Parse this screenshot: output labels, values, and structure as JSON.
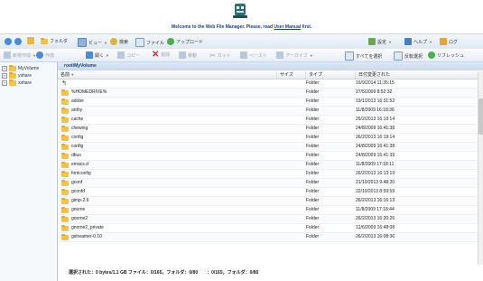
{
  "banner": {
    "welcome_text": "Welcome to the Web File Manager. Please, read",
    "manual_link": "User Manual",
    "welcome_suffix": "first."
  },
  "toolbar1": {
    "folder_label": "フォルダ",
    "view_label": "ビュー",
    "search_label": "検索",
    "file_label": "ファイル",
    "upload_label": "アップロード",
    "settings_label": "設定",
    "help_label": "ヘルプ",
    "logout_label": "ログ"
  },
  "toolbar2": {
    "new_label": "新規作成",
    "create_label": "作成",
    "open_label": "開く",
    "edit_label": "コピー",
    "delete_label": "削除",
    "copy_label": "移動",
    "cut_label": "カット",
    "paste_label": "ペースト",
    "properties_label": "アーカイブ",
    "select_all_label": "すべてを選択",
    "invert_label": "反転選択",
    "refresh_label": "リフレッシュ"
  },
  "tree": {
    "items": [
      {
        "label": "MyVolume"
      },
      {
        "label": "yshare"
      },
      {
        "label": "xshare"
      }
    ]
  },
  "main": {
    "path": "root\\MyVolume",
    "columns": {
      "name": "名前",
      "size": "サイズ",
      "type": "タイプ",
      "date": "日付変更された"
    },
    "rows": [
      {
        "name": "",
        "type": "Folder",
        "date": "16/9/2014 11:35:15",
        "up": true
      },
      {
        "name": "%HOMEDRIVE%",
        "type": "Folder",
        "date": "27/5/2009 8:52:32"
      },
      {
        "name": "adobe",
        "type": "Folder",
        "date": "19/1/2013 16:31:52"
      },
      {
        "name": "anthy",
        "type": "Folder",
        "date": "11/8/2009 16:18:36"
      },
      {
        "name": "cache",
        "type": "Folder",
        "date": "26/2/2013 16:19:14"
      },
      {
        "name": "chewing",
        "type": "Folder",
        "date": "24/8/2009 16:41:38"
      },
      {
        "name": "config",
        "type": "Folder",
        "date": "26/2/2013 16:19:14"
      },
      {
        "name": "config",
        "type": "Folder",
        "date": "24/8/2009 16:41:38"
      },
      {
        "name": "dbus",
        "type": "Folder",
        "date": "24/8/2009 16:41:39"
      },
      {
        "name": "emacs.d",
        "type": "Folder",
        "date": "11/8/2009 17:18:11"
      },
      {
        "name": "fontconfig",
        "type": "Folder",
        "date": "26/2/2013 16:13:19"
      },
      {
        "name": "gconf",
        "type": "Folder",
        "date": "21/10/2013 9:48:20"
      },
      {
        "name": "gconfd",
        "type": "Folder",
        "date": "22/10/2013 8:59:59"
      },
      {
        "name": "gimp-2.6",
        "type": "Folder",
        "date": "26/2/2013 16:16:13"
      },
      {
        "name": "gnome",
        "type": "Folder",
        "date": "11/8/2009 17:18:44"
      },
      {
        "name": "gnome2",
        "type": "Folder",
        "date": "26/2/2013 16:20:26"
      },
      {
        "name": "gnome2_private",
        "type": "Folder",
        "date": "12/6/2009 16:48:08"
      },
      {
        "name": "gstreamer-0.10",
        "type": "Folder",
        "date": "26/2/2013 16:08:36"
      }
    ]
  },
  "status": {
    "text": "選択された：0 bytes/1.1 GB ファイル：0/165，フォルダ：0/80　　：0/165，フォルダ：0/80"
  },
  "colors": {
    "accent": "#15428b",
    "folder": "#f2c34a",
    "toolbar_bg": "#dde7f2"
  }
}
